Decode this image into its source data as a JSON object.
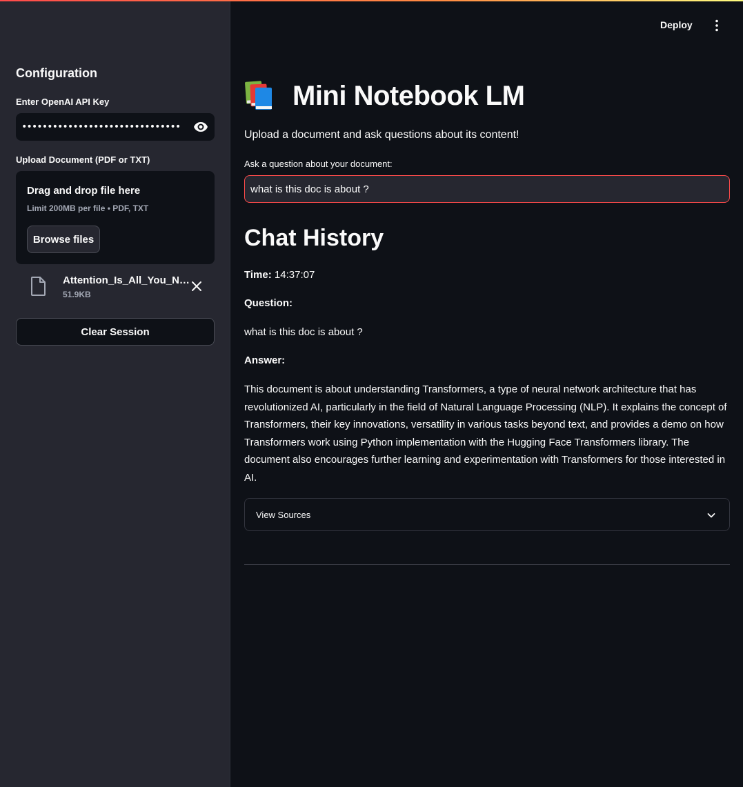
{
  "topbar": {
    "deploy_label": "Deploy"
  },
  "sidebar": {
    "title": "Configuration",
    "api_key": {
      "label": "Enter OpenAI API Key",
      "value": "••••••••••••••••••••••••••••••••••••••••••••••••••••"
    },
    "upload": {
      "label": "Upload Document (PDF or TXT)",
      "drop_title": "Drag and drop file here",
      "drop_subtitle": "Limit 200MB per file • PDF, TXT",
      "browse_label": "Browse files"
    },
    "file": {
      "name": "Attention_Is_All_You_Need.pdf",
      "size": "51.9KB"
    },
    "clear_label": "Clear Session"
  },
  "main": {
    "title": "Mini Notebook LM",
    "subtitle": "Upload a document and ask questions about its content!",
    "question_label": "Ask a question about your document:",
    "question_value": "what is this doc is about ?",
    "history_heading": "Chat History",
    "history": [
      {
        "time_label": "Time:",
        "time": "14:37:07",
        "question_label": "Question:",
        "question": "what is this doc is about ?",
        "answer_label": "Answer:",
        "answer": "This document is about understanding Transformers, a type of neural network architecture that has revolutionized AI, particularly in the field of Natural Language Processing (NLP). It explains the concept of Transformers, their key innovations, versatility in various tasks beyond text, and provides a demo on how Transformers work using Python implementation with the Hugging Face Transformers library. The document also encourages further learning and experimentation with Transformers for those interested in AI.",
        "sources_label": "View Sources"
      }
    ]
  },
  "icons": {
    "eye": "eye-icon",
    "file": "file-icon",
    "close": "close-icon",
    "kebab": "more-vertical-icon",
    "books": "books-icon",
    "chevron": "chevron-down-icon"
  },
  "colors": {
    "background": "#0e1117",
    "sidebar": "#262730",
    "accent": "#ff4b4b",
    "text": "#fafafa",
    "muted": "#a3a8b4"
  }
}
